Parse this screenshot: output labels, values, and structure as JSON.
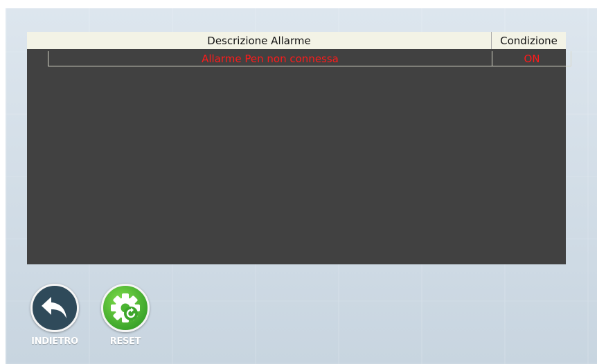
{
  "table": {
    "headers": [
      "Descrizione Allarme",
      "Condizione"
    ],
    "rows": [
      {
        "description": "Allarme Pen non connessa",
        "condition": "ON"
      }
    ]
  },
  "buttons": {
    "back_label": "INDIETRO",
    "reset_label": "RESET"
  },
  "colors": {
    "alarm_text": "#ff1a1a",
    "panel_bg": "#414141",
    "header_bg": "#f3f3e6",
    "back_button": "#2f4a5a",
    "reset_button": "#3da62b"
  },
  "icons": {
    "back": "undo-arrow-icon",
    "reset": "gear-reset-icon"
  }
}
